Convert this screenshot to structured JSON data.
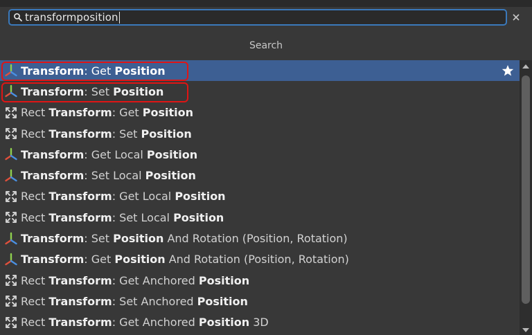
{
  "search": {
    "value": "transformposition"
  },
  "header": {
    "title": "Search"
  },
  "results": [
    {
      "kind": "transform",
      "selected": true,
      "favorite": true,
      "segments": [
        {
          "t": "Transform",
          "b": true
        },
        {
          "t": ": Get ",
          "b": false
        },
        {
          "t": "Position",
          "b": true
        }
      ]
    },
    {
      "kind": "transform",
      "segments": [
        {
          "t": "Transform",
          "b": true
        },
        {
          "t": ": Set ",
          "b": false
        },
        {
          "t": "Position",
          "b": true
        }
      ]
    },
    {
      "kind": "rect",
      "segments": [
        {
          "t": "Rect ",
          "b": false
        },
        {
          "t": "Transform",
          "b": true
        },
        {
          "t": ": Get ",
          "b": false
        },
        {
          "t": "Position",
          "b": true
        }
      ]
    },
    {
      "kind": "rect",
      "segments": [
        {
          "t": "Rect ",
          "b": false
        },
        {
          "t": "Transform",
          "b": true
        },
        {
          "t": ": Set ",
          "b": false
        },
        {
          "t": "Position",
          "b": true
        }
      ]
    },
    {
      "kind": "transform",
      "segments": [
        {
          "t": "Transform",
          "b": true
        },
        {
          "t": ": Get Local ",
          "b": false
        },
        {
          "t": "Position",
          "b": true
        }
      ]
    },
    {
      "kind": "transform",
      "segments": [
        {
          "t": "Transform",
          "b": true
        },
        {
          "t": ": Set Local ",
          "b": false
        },
        {
          "t": "Position",
          "b": true
        }
      ]
    },
    {
      "kind": "rect",
      "segments": [
        {
          "t": "Rect ",
          "b": false
        },
        {
          "t": "Transform",
          "b": true
        },
        {
          "t": ": Get Local ",
          "b": false
        },
        {
          "t": "Position",
          "b": true
        }
      ]
    },
    {
      "kind": "rect",
      "segments": [
        {
          "t": "Rect ",
          "b": false
        },
        {
          "t": "Transform",
          "b": true
        },
        {
          "t": ": Set Local ",
          "b": false
        },
        {
          "t": "Position",
          "b": true
        }
      ]
    },
    {
      "kind": "transform",
      "segments": [
        {
          "t": "Transform",
          "b": true
        },
        {
          "t": ": Set ",
          "b": false
        },
        {
          "t": "Position",
          "b": true
        },
        {
          "t": " And Rotation (Position, Rotation)",
          "b": false
        }
      ]
    },
    {
      "kind": "transform",
      "segments": [
        {
          "t": "Transform",
          "b": true
        },
        {
          "t": ": Get ",
          "b": false
        },
        {
          "t": "Position",
          "b": true
        },
        {
          "t": " And Rotation (Position, Rotation)",
          "b": false
        }
      ]
    },
    {
      "kind": "rect",
      "segments": [
        {
          "t": "Rect ",
          "b": false
        },
        {
          "t": "Transform",
          "b": true
        },
        {
          "t": ": Get Anchored ",
          "b": false
        },
        {
          "t": "Position",
          "b": true
        }
      ]
    },
    {
      "kind": "rect",
      "segments": [
        {
          "t": "Rect ",
          "b": false
        },
        {
          "t": "Transform",
          "b": true
        },
        {
          "t": ": Set Anchored ",
          "b": false
        },
        {
          "t": "Position",
          "b": true
        }
      ]
    },
    {
      "kind": "rect",
      "segments": [
        {
          "t": "Rect ",
          "b": false
        },
        {
          "t": "Transform",
          "b": true
        },
        {
          "t": ": Get Anchored ",
          "b": false
        },
        {
          "t": "Position",
          "b": true
        },
        {
          "t": " 3D",
          "b": false
        }
      ]
    }
  ],
  "icons": {
    "transform": "transform-axes-icon",
    "rect": "rect-transform-icon",
    "favorite": "star-icon",
    "search": "search-icon",
    "clear": "close-icon"
  },
  "colors": {
    "selection": "#3d5f93",
    "focus_border": "#3a79bb",
    "highlight": "#e01515",
    "axis_x": "#e0503c",
    "axis_y": "#8fd14f",
    "axis_z": "#4a90e2"
  }
}
